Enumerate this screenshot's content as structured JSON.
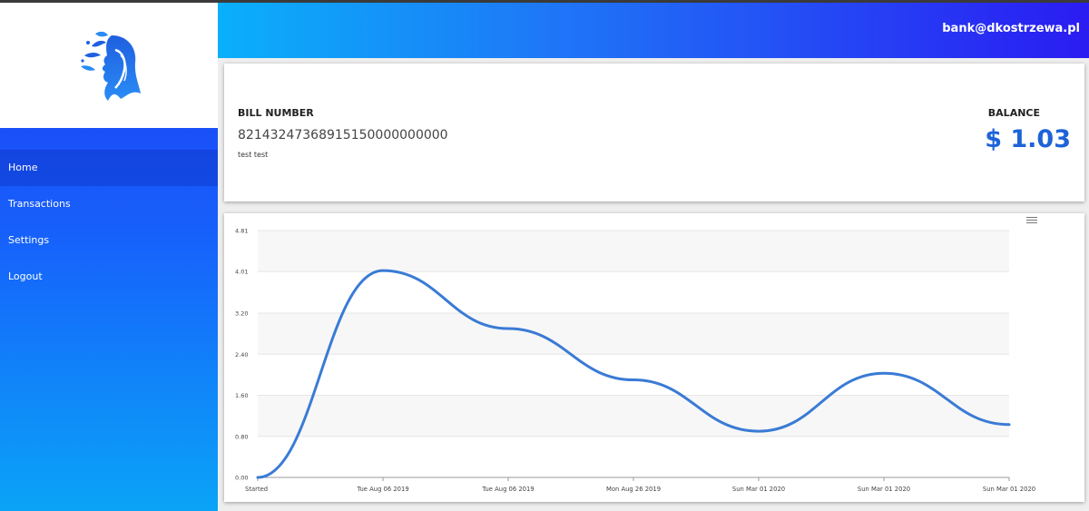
{
  "header": {
    "user_email": "bank@dkostrzewa.pl"
  },
  "sidebar": {
    "logo_icon": "woman-profile-logo",
    "items": [
      {
        "label": "Home",
        "active": true
      },
      {
        "label": "Transactions",
        "active": false
      },
      {
        "label": "Settings",
        "active": false
      },
      {
        "label": "Logout",
        "active": false
      }
    ]
  },
  "bill": {
    "title": "BILL NUMBER",
    "number": "82143247368915150000000000",
    "owner": "test test"
  },
  "balance": {
    "title": "BALANCE",
    "value": "$ 1.03"
  },
  "chart_menu_icon": "hamburger-menu-icon",
  "colors": {
    "accent": "#1e63d8",
    "line": "#3a7bd5",
    "band": "#f7f7f7"
  },
  "chart_data": {
    "type": "line",
    "categories": [
      "Started",
      "Tue Aug 06 2019",
      "Tue Aug 06 2019",
      "Mon Aug 26 2019",
      "Sun Mar 01 2020",
      "Sun Mar 01 2020",
      "Sun Mar 01 2020"
    ],
    "series": [
      {
        "values": [
          0,
          4.03,
          2.9,
          1.9,
          0.9,
          2.03,
          1.03
        ]
      }
    ],
    "yticks": [
      "0.00",
      "0.80",
      "1.60",
      "2.40",
      "3.20",
      "4.01",
      "4.81"
    ],
    "ylim": [
      0,
      4.81
    ],
    "title": "",
    "xlabel": "",
    "ylabel": "",
    "grid": true
  }
}
